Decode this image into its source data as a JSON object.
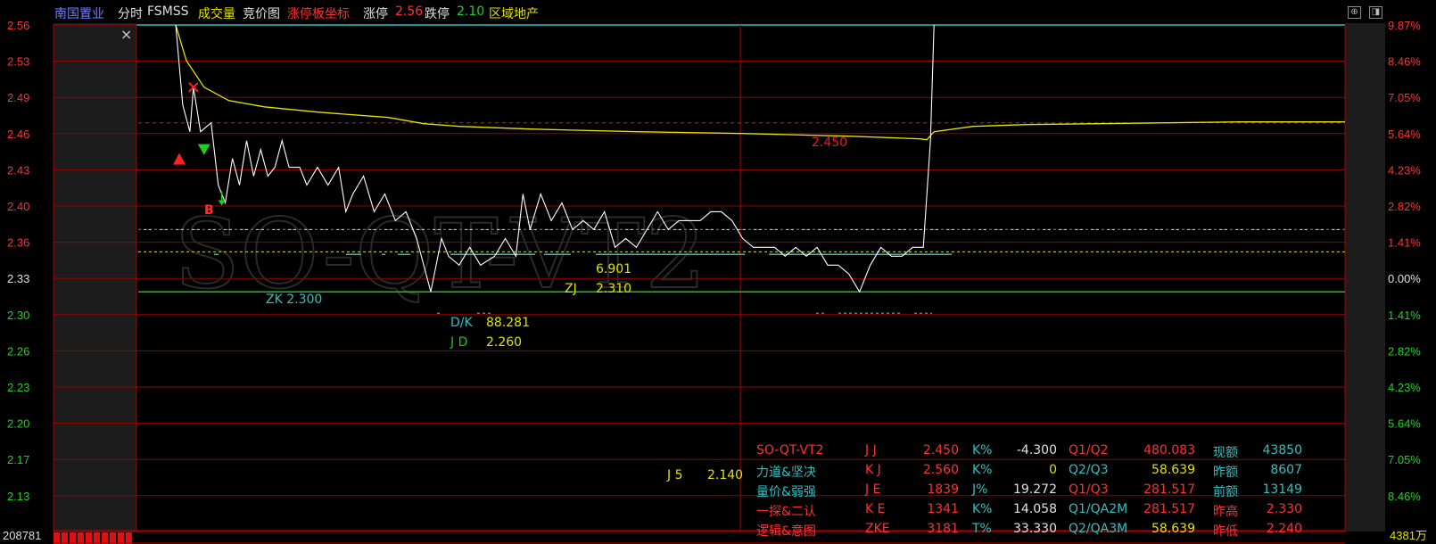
{
  "header": {
    "stock_name": "南国置业",
    "mode": "分时",
    "indicator": "FSMSS",
    "volume_label": "成交量",
    "auction_label": "竞价图",
    "limit_up_marker": "涨停板坐标",
    "limit_up_label": "涨停",
    "limit_up_value": "2.56",
    "limit_down_label": "跌停",
    "limit_down_value": "2.10",
    "sector": "区域地产"
  },
  "window_buttons": {
    "expand": "⊕",
    "restore": "◨"
  },
  "close_glyph": "×",
  "left_axis": [
    "2.56",
    "2.53",
    "2.49",
    "2.46",
    "2.43",
    "2.40",
    "2.36",
    "2.33",
    "2.30",
    "2.26",
    "2.23",
    "2.20",
    "2.17",
    "2.13"
  ],
  "right_axis": [
    "9.87%",
    "8.46%",
    "7.05%",
    "5.64%",
    "4.23%",
    "2.82%",
    "1.41%",
    "0.00%",
    "1.41%",
    "2.82%",
    "4.23%",
    "5.64%",
    "7.05%",
    "8.46%"
  ],
  "volume_left": "208781",
  "volume_right": "4381万",
  "watermark": "SO-QT-VT2",
  "chart_labels": {
    "level_2450": "2.450",
    "zk": "ZK 2.300",
    "dk_label": "D/K",
    "dk_value": "88.281",
    "jd_label": "J D",
    "jd_value": "2.260",
    "value_6901": "6.901",
    "zj_label": "ZJ",
    "zj_value": "2.310",
    "j5_label": "J 5",
    "j5_value": "2.140",
    "b_marker": "B"
  },
  "info_rows": [
    {
      "c1": "SO-QT-VT2",
      "c2": "J J",
      "c3": "2.450",
      "c4": "K%",
      "c5": "-4.300",
      "c6": "Q1/Q2",
      "c7": "480.083",
      "c8": "现额",
      "c9": "43850"
    },
    {
      "c1": "力道&坚决",
      "c2": "K J",
      "c3": "2.560",
      "c4": "K%",
      "c5": "0",
      "c6": "Q2/Q3",
      "c7": "58.639",
      "c8": "昨额",
      "c9": "8607"
    },
    {
      "c1": "量价&弱强",
      "c2": "J E",
      "c3": "1839",
      "c4": "J%",
      "c5": "19.272",
      "c6": "Q1/Q3",
      "c7": "281.517",
      "c8": "前额",
      "c9": "13149"
    },
    {
      "c1": "一探&二认",
      "c2": "K E",
      "c3": "1341",
      "c4": "K%",
      "c5": "14.058",
      "c6": "Q1/QA2M",
      "c7": "281.517",
      "c8": "昨高",
      "c9": "2.330"
    },
    {
      "c1": "逻辑&意图",
      "c2": "ZKE",
      "c3": "3181",
      "c4": "T%",
      "c5": "33.330",
      "c6": "Q2/QA3M",
      "c7": "58.639",
      "c8": "昨低",
      "c9": "2.240"
    }
  ],
  "chart_data": {
    "type": "line",
    "title": "南国置业 分时",
    "y_axis_range": [
      2.1,
      2.56
    ],
    "reference_price": 2.33,
    "limit_up": 2.56,
    "limit_down": 2.1,
    "lines": {
      "hline_2450": 2.45,
      "hline_zk": 2.3,
      "hline_jd": 2.26
    },
    "series": [
      {
        "name": "price",
        "color": "#ffffff",
        "points": [
          [
            0,
            2.56
          ],
          [
            2,
            2.47
          ],
          [
            4,
            2.44
          ],
          [
            5,
            2.49
          ],
          [
            7,
            2.44
          ],
          [
            10,
            2.45
          ],
          [
            12,
            2.38
          ],
          [
            14,
            2.36
          ],
          [
            16,
            2.41
          ],
          [
            18,
            2.38
          ],
          [
            20,
            2.43
          ],
          [
            22,
            2.39
          ],
          [
            24,
            2.42
          ],
          [
            26,
            2.39
          ],
          [
            28,
            2.4
          ],
          [
            30,
            2.43
          ],
          [
            32,
            2.4
          ],
          [
            35,
            2.4
          ],
          [
            37,
            2.38
          ],
          [
            40,
            2.4
          ],
          [
            43,
            2.38
          ],
          [
            46,
            2.4
          ],
          [
            48,
            2.35
          ],
          [
            50,
            2.37
          ],
          [
            53,
            2.39
          ],
          [
            56,
            2.35
          ],
          [
            59,
            2.37
          ],
          [
            62,
            2.34
          ],
          [
            65,
            2.35
          ],
          [
            68,
            2.32
          ],
          [
            72,
            2.26
          ],
          [
            75,
            2.32
          ],
          [
            77,
            2.3
          ],
          [
            80,
            2.29
          ],
          [
            83,
            2.31
          ],
          [
            86,
            2.29
          ],
          [
            90,
            2.3
          ],
          [
            93,
            2.32
          ],
          [
            96,
            2.3
          ],
          [
            98,
            2.37
          ],
          [
            100,
            2.33
          ],
          [
            103,
            2.37
          ],
          [
            106,
            2.34
          ],
          [
            109,
            2.36
          ],
          [
            112,
            2.33
          ],
          [
            115,
            2.34
          ],
          [
            118,
            2.33
          ],
          [
            121,
            2.35
          ],
          [
            124,
            2.31
          ],
          [
            127,
            2.32
          ],
          [
            130,
            2.31
          ],
          [
            133,
            2.33
          ],
          [
            136,
            2.35
          ],
          [
            139,
            2.33
          ],
          [
            142,
            2.34
          ],
          [
            145,
            2.34
          ],
          [
            148,
            2.34
          ],
          [
            151,
            2.35
          ],
          [
            154,
            2.35
          ],
          [
            157,
            2.34
          ],
          [
            160,
            2.32
          ],
          [
            163,
            2.31
          ],
          [
            166,
            2.31
          ],
          [
            169,
            2.31
          ],
          [
            172,
            2.3
          ],
          [
            175,
            2.31
          ],
          [
            178,
            2.3
          ],
          [
            181,
            2.31
          ],
          [
            184,
            2.29
          ],
          [
            187,
            2.29
          ],
          [
            190,
            2.28
          ],
          [
            193,
            2.26
          ],
          [
            196,
            2.29
          ],
          [
            199,
            2.31
          ],
          [
            202,
            2.3
          ],
          [
            205,
            2.3
          ],
          [
            208,
            2.31
          ],
          [
            211,
            2.31
          ],
          [
            213,
            2.43
          ],
          [
            214,
            2.56
          ]
        ]
      },
      {
        "name": "avg",
        "color": "#e6e600",
        "points": [
          [
            0,
            2.56
          ],
          [
            3,
            2.52
          ],
          [
            8,
            2.49
          ],
          [
            15,
            2.475
          ],
          [
            25,
            2.468
          ],
          [
            40,
            2.462
          ],
          [
            60,
            2.456
          ],
          [
            70,
            2.449
          ],
          [
            80,
            2.446
          ],
          [
            100,
            2.443
          ],
          [
            130,
            2.44
          ],
          [
            160,
            2.438
          ],
          [
            190,
            2.435
          ],
          [
            210,
            2.432
          ],
          [
            212,
            2.431
          ],
          [
            214,
            2.44
          ],
          [
            225,
            2.446
          ],
          [
            240,
            2.448
          ],
          [
            300,
            2.451
          ],
          [
            330,
            2.451
          ]
        ]
      }
    ],
    "total_minutes": 330,
    "signals": [
      {
        "type": "buy-up",
        "minute": 1,
        "price": 2.41,
        "color": "#ff2020"
      },
      {
        "type": "cross",
        "minute": 5,
        "price": 2.49,
        "color": "#ff2020"
      },
      {
        "type": "sell-down",
        "minute": 8,
        "price": 2.42,
        "color": "#20d020"
      },
      {
        "type": "arrow-down",
        "minute": 13,
        "price": 2.365,
        "color": "#20d020"
      }
    ]
  }
}
